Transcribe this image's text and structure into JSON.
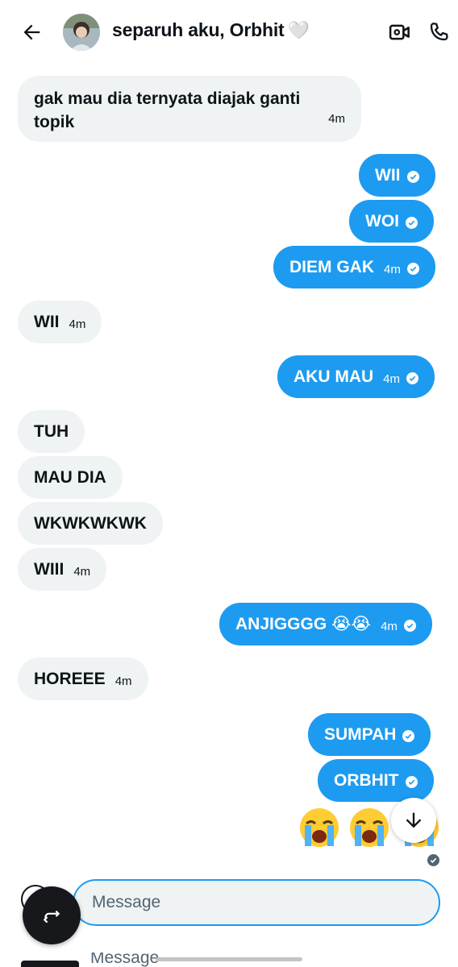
{
  "header": {
    "title": "separuh aku, Orbhit",
    "title_emoji": "🤍",
    "back_icon": "arrow-left-icon",
    "video_icon": "video-call-icon",
    "phone_icon": "phone-call-icon"
  },
  "messages": [
    {
      "side": "in",
      "text": "gak mau dia ternyata diajak ganti topik",
      "time": "4m"
    },
    {
      "side": "out",
      "text": "WII",
      "time": ""
    },
    {
      "side": "out",
      "text": "WOI",
      "time": ""
    },
    {
      "side": "out",
      "text": "DIEM GAK",
      "time": "4m"
    },
    {
      "side": "in",
      "text": "WII",
      "time": "4m"
    },
    {
      "side": "out",
      "text": "AKU MAU",
      "time": "4m"
    },
    {
      "side": "in",
      "text": "TUH",
      "time": ""
    },
    {
      "side": "in",
      "text": "MAU DIA",
      "time": ""
    },
    {
      "side": "in",
      "text": "WKWKWKWK",
      "time": ""
    },
    {
      "side": "in",
      "text": "WIII",
      "time": "4m"
    },
    {
      "side": "out",
      "text": "ANJIGGGG 😭😭",
      "time": "4m"
    },
    {
      "side": "in",
      "text": "HOREEE",
      "time": "4m"
    },
    {
      "side": "out",
      "text": "SUMPAH",
      "time": ""
    },
    {
      "side": "out",
      "text": "ORBHIT",
      "time": ""
    }
  ],
  "emoji_message": "😭😭😭",
  "composer": {
    "placeholder": "Message",
    "ghost_text": "Message"
  },
  "colors": {
    "accent": "#1d9bf0",
    "incoming_bubble": "#eff3f4",
    "text": "#0f1419",
    "muted": "#536471"
  }
}
